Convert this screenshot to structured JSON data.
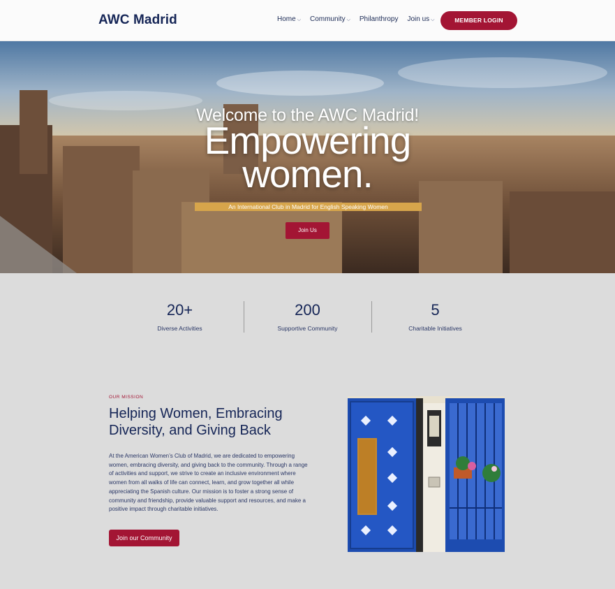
{
  "header": {
    "logo": "AWC Madrid",
    "nav": [
      {
        "label": "Home",
        "has_dropdown": true
      },
      {
        "label": "Community",
        "has_dropdown": true
      },
      {
        "label": "Philanthropy",
        "has_dropdown": false
      },
      {
        "label": "Join us",
        "has_dropdown": true
      }
    ],
    "login_label": "MEMBER LOGIN"
  },
  "hero": {
    "welcome": "Welcome to the AWC Madrid!",
    "title_line1": "Empowering",
    "title_line2": "women.",
    "subtitle": "An International Club in Madrid for English Speaking Women",
    "cta": "Join Us"
  },
  "stats": [
    {
      "value": "20+",
      "label": "Diverse Activities"
    },
    {
      "value": "200",
      "label": "Supportive Community"
    },
    {
      "value": "5",
      "label": "Charitable Initiatives"
    }
  ],
  "mission": {
    "kicker": "OUR MISSION",
    "title": "Helping Women, Embracing Diversity, and Giving Back",
    "body": "At the American Women’s Club of Madrid, we are dedicated to empowering women, embracing diversity, and giving back to the community. Through a range of activities and support, we strive to create an inclusive environment where women from all walks of life can connect, learn, and grow together all while appreciating the Spanish culture. Our mission is to foster a strong sense of community and friendship, provide valuable support and resources, and make a positive impact through charitable initiatives.",
    "cta": "Join our Community"
  },
  "colors": {
    "accent": "#a31534",
    "navy": "#152556",
    "gold": "#d7a54b",
    "background": "#dcdcdc"
  }
}
